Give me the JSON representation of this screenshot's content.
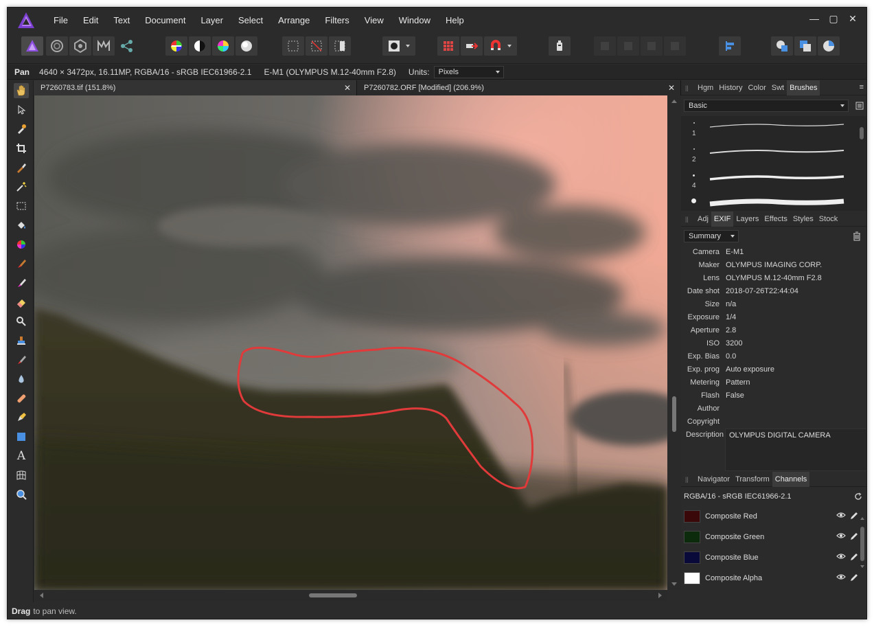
{
  "menu": {
    "items": [
      "File",
      "Edit",
      "Text",
      "Document",
      "Layer",
      "Select",
      "Arrange",
      "Filters",
      "View",
      "Window",
      "Help"
    ]
  },
  "context": {
    "tool": "Pan",
    "doc_info": "4640 × 3472px, 16.11MP, RGBA/16 - sRGB IEC61966-2.1",
    "camera_info": "E-M1 (OLYMPUS M.12-40mm F2.8)",
    "units_label": "Units:",
    "units_value": "Pixels"
  },
  "tabs": {
    "doc1": "P7260783.tif (151.8%)",
    "doc2": "P7260782.ORF [Modified] (206.9%)"
  },
  "brushes_panel": {
    "tabs": [
      "Hgm",
      "History",
      "Color",
      "Swt",
      "Brushes"
    ],
    "category": "Basic",
    "brush_sizes": [
      "1",
      "2",
      "4"
    ]
  },
  "exif_panel": {
    "tabs": [
      "Adj",
      "EXIF",
      "Layers",
      "Effects",
      "Styles",
      "Stock"
    ],
    "mode": "Summary",
    "rows": [
      {
        "k": "Camera",
        "v": "E-M1"
      },
      {
        "k": "Maker",
        "v": "OLYMPUS IMAGING CORP."
      },
      {
        "k": "Lens",
        "v": "OLYMPUS M.12-40mm F2.8"
      },
      {
        "k": "Date shot",
        "v": "2018-07-26T22:44:04"
      },
      {
        "k": "Size",
        "v": "n/a"
      },
      {
        "k": "Exposure",
        "v": "1/4"
      },
      {
        "k": "Aperture",
        "v": "2.8"
      },
      {
        "k": "ISO",
        "v": "3200"
      },
      {
        "k": "Exp. Bias",
        "v": "0.0"
      },
      {
        "k": "Exp. prog",
        "v": "Auto exposure"
      },
      {
        "k": "Metering",
        "v": "Pattern"
      },
      {
        "k": "Flash",
        "v": "False"
      },
      {
        "k": "Author",
        "v": ""
      },
      {
        "k": "Copyright",
        "v": ""
      }
    ],
    "description_label": "Description",
    "description_value": "OLYMPUS DIGITAL CAMERA"
  },
  "channels_panel": {
    "tabs": [
      "Navigator",
      "Transform",
      "Channels"
    ],
    "profile": "RGBA/16 - sRGB IEC61966-2.1",
    "channels": [
      {
        "name": "Composite Red",
        "color": "#3a0808"
      },
      {
        "name": "Composite Green",
        "color": "#0c2a0c"
      },
      {
        "name": "Composite Blue",
        "color": "#0a0a3a"
      },
      {
        "name": "Composite Alpha",
        "color": "#ffffff"
      }
    ]
  },
  "status": {
    "bold": "Drag",
    "text": "to pan view."
  },
  "colors": {
    "annotation": "#e03a3a",
    "accent": "#7b3fd0"
  }
}
